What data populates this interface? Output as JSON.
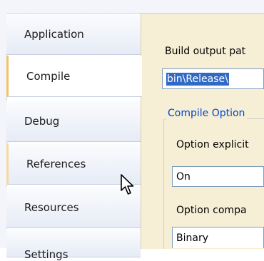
{
  "tabs": [
    {
      "label": "Application"
    },
    {
      "label": "Compile"
    },
    {
      "label": "Debug"
    },
    {
      "label": "References"
    },
    {
      "label": "Resources"
    },
    {
      "label": "Settings"
    }
  ],
  "selected_tab": "Compile",
  "content": {
    "build_output_label": "Build output pat",
    "build_output_value": "bin\\Release\\",
    "group_title": "Compile Option",
    "option_explicit_label": "Option explicit",
    "option_explicit_value": "On",
    "option_compare_label": "Option compa",
    "option_compare_value": "Binary"
  },
  "colors": {
    "selected_tab_accent": "#f4c169",
    "panel_background": "#f6efd6",
    "group_title": "#0046d5",
    "selection_highlight": "#316ac5"
  },
  "icons": {
    "cursor": "mouse-pointer-arrow"
  }
}
